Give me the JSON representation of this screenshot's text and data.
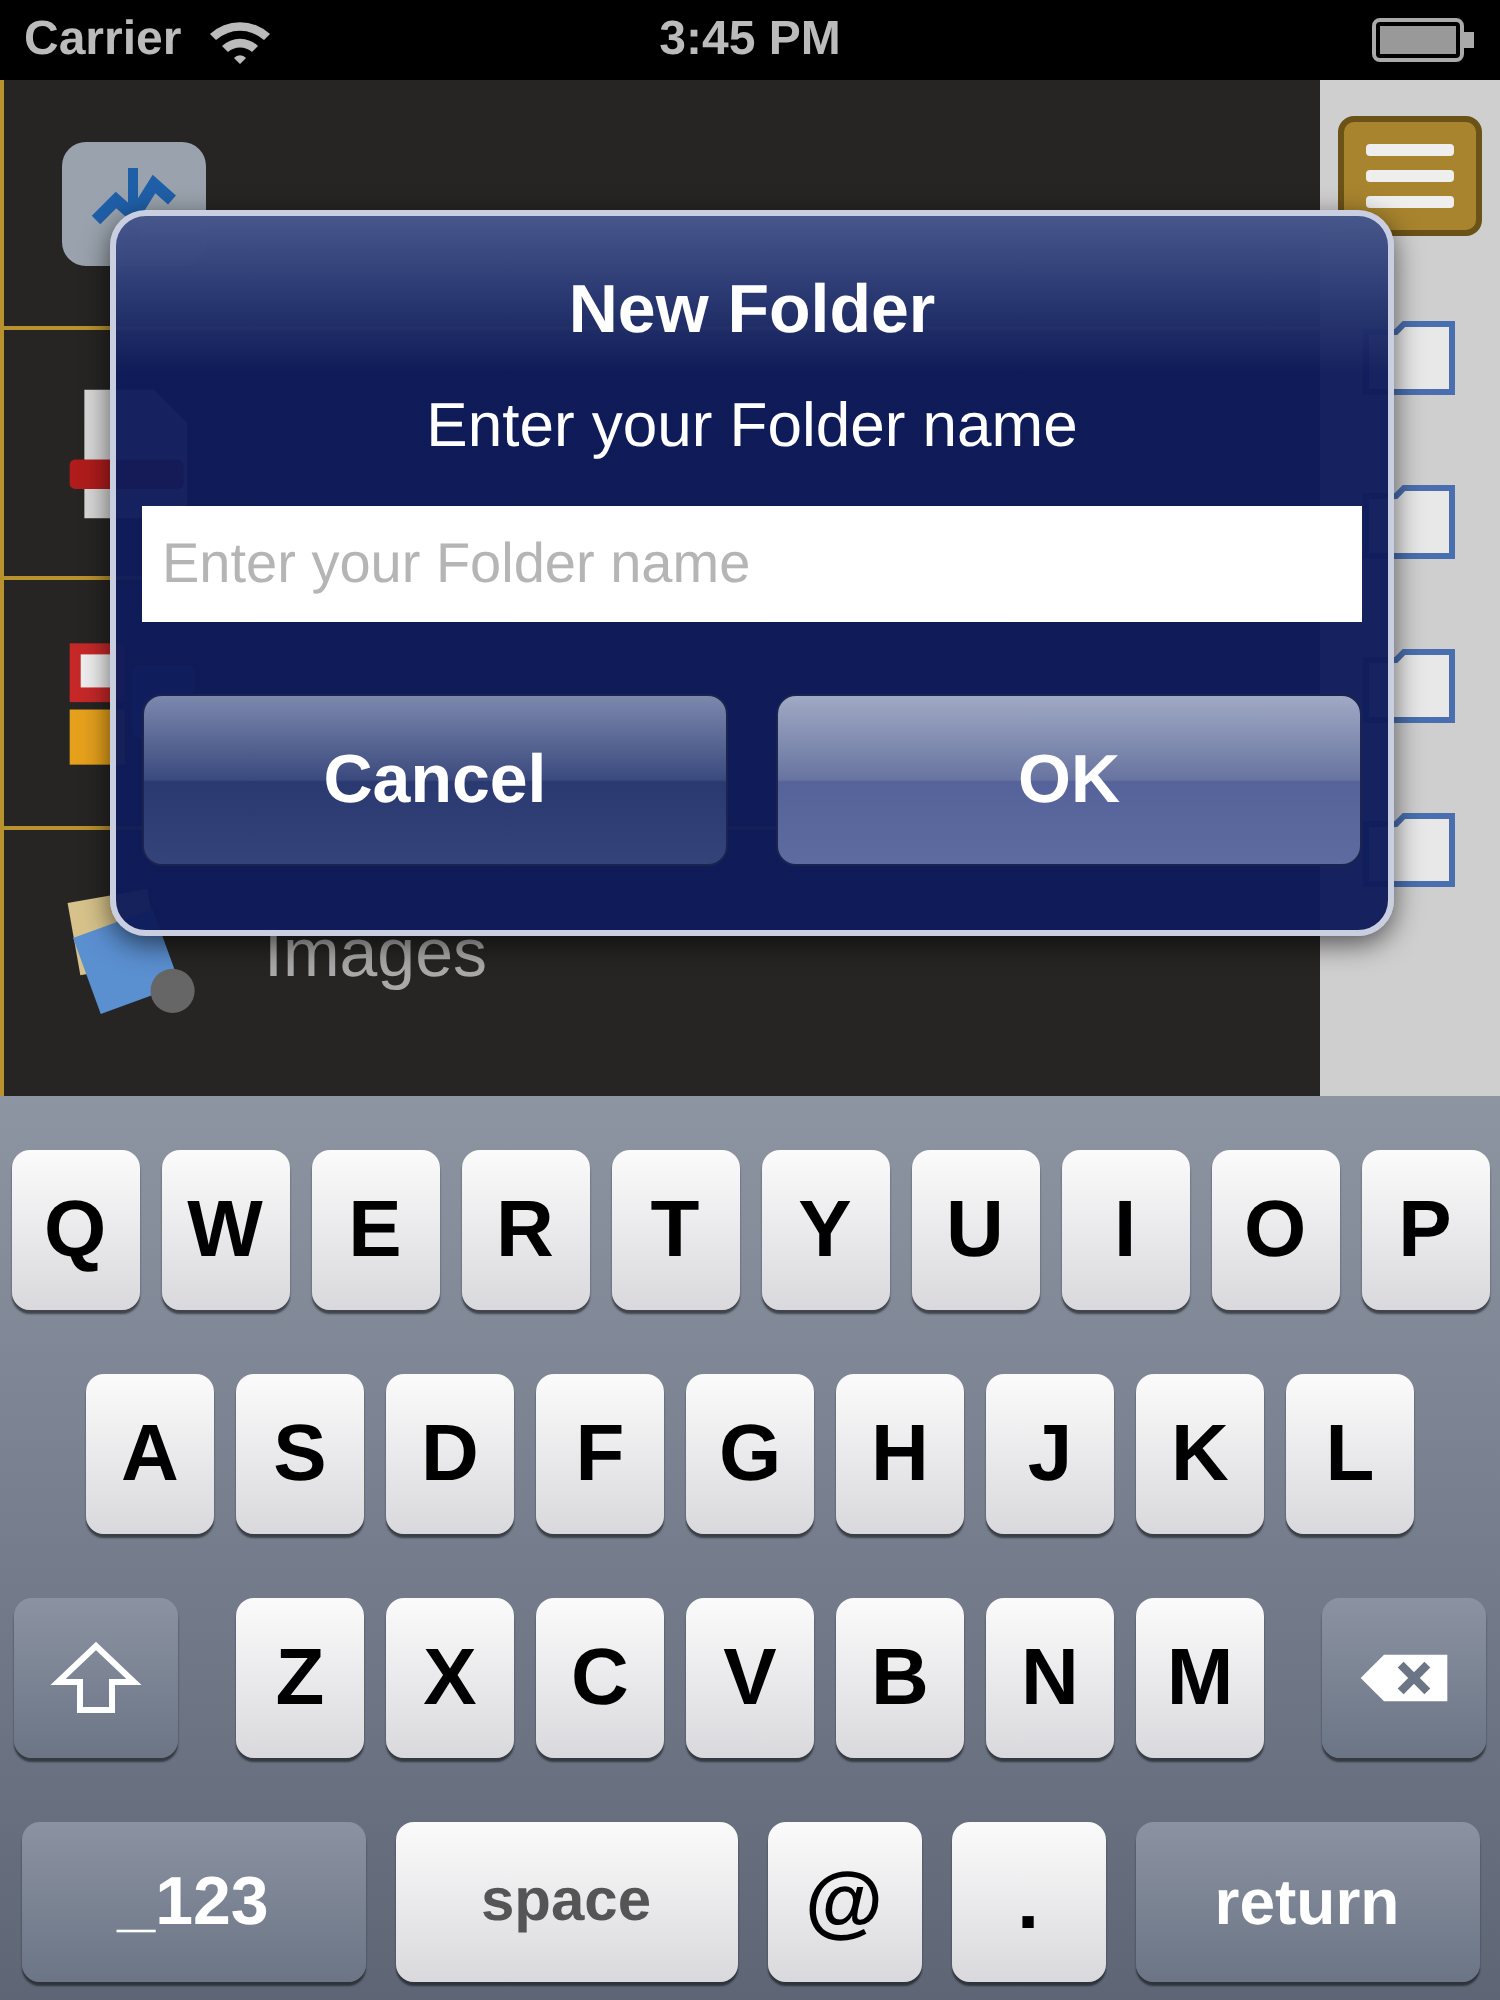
{
  "status_bar": {
    "carrier": "Carrier",
    "time": "3:45 PM"
  },
  "sidebar": {
    "items": [
      {
        "label": "Images"
      }
    ]
  },
  "dialog": {
    "title": "New Folder",
    "message": "Enter your Folder name",
    "field": {
      "placeholder": "Enter your Folder name"
    },
    "buttons": [
      {
        "label": "Cancel"
      },
      {
        "label": "OK"
      }
    ]
  },
  "keyboard": {
    "letter_rows": [
      [
        {
          "kind": "letter",
          "label": "Q"
        },
        {
          "kind": "letter",
          "label": "W"
        },
        {
          "kind": "letter",
          "label": "E"
        },
        {
          "kind": "letter",
          "label": "R"
        },
        {
          "kind": "letter",
          "label": "T"
        },
        {
          "kind": "letter",
          "label": "Y"
        },
        {
          "kind": "letter",
          "label": "U"
        },
        {
          "kind": "letter",
          "label": "I"
        },
        {
          "kind": "letter",
          "label": "O"
        },
        {
          "kind": "letter",
          "label": "P"
        }
      ],
      [
        {
          "kind": "letter",
          "label": "A"
        },
        {
          "kind": "letter",
          "label": "S"
        },
        {
          "kind": "letter",
          "label": "D"
        },
        {
          "kind": "letter",
          "label": "F"
        },
        {
          "kind": "letter",
          "label": "G"
        },
        {
          "kind": "letter",
          "label": "H"
        },
        {
          "kind": "letter",
          "label": "J"
        },
        {
          "kind": "letter",
          "label": "K"
        },
        {
          "kind": "letter",
          "label": "L"
        }
      ],
      [
        {
          "kind": "shift"
        },
        {
          "kind": "letter",
          "label": "Z"
        },
        {
          "kind": "letter",
          "label": "X"
        },
        {
          "kind": "letter",
          "label": "C"
        },
        {
          "kind": "letter",
          "label": "V"
        },
        {
          "kind": "letter",
          "label": "B"
        },
        {
          "kind": "letter",
          "label": "N"
        },
        {
          "kind": "letter",
          "label": "M"
        },
        {
          "kind": "delete"
        }
      ]
    ],
    "bottom_row": {
      "numbers_key": "_123",
      "space_key": "space",
      "at_key": "@",
      "dot_key": ".",
      "return_key": "return"
    }
  }
}
